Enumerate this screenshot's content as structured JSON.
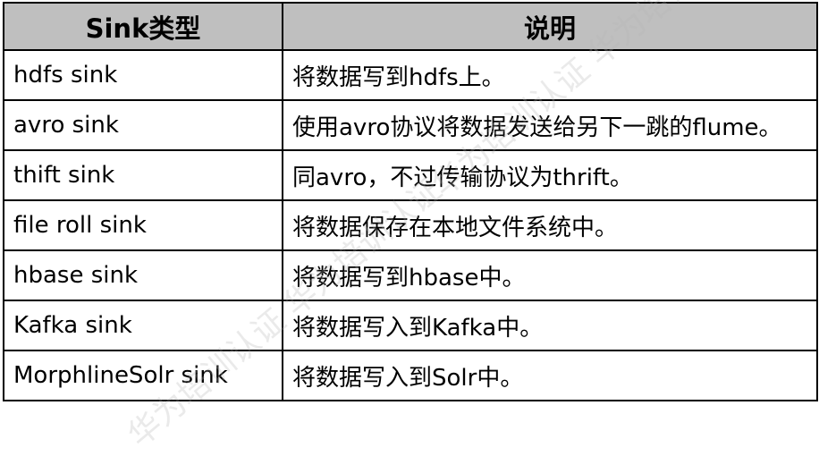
{
  "table": {
    "headers": [
      "Sink类型",
      "说明"
    ],
    "rows": [
      [
        "hdfs sink",
        "将数据写到hdfs上。"
      ],
      [
        "avro sink",
        "使用avro协议将数据发送给另下一跳的flume。"
      ],
      [
        "thift sink",
        "同avro，不过传输协议为thrift。"
      ],
      [
        "file roll sink",
        "将数据保存在本地文件系统中。"
      ],
      [
        "hbase sink",
        "将数据写到hbase中。"
      ],
      [
        "Kafka sink",
        "将数据写入到Kafka中。"
      ],
      [
        "MorphlineSolr sink",
        "将数据写入到Solr中。"
      ]
    ]
  },
  "watermark": {
    "text": "华为培训认证 华为培训认证"
  },
  "colors": {
    "header_bg": "#bfbfbf",
    "border": "#000000",
    "text": "#000000"
  }
}
